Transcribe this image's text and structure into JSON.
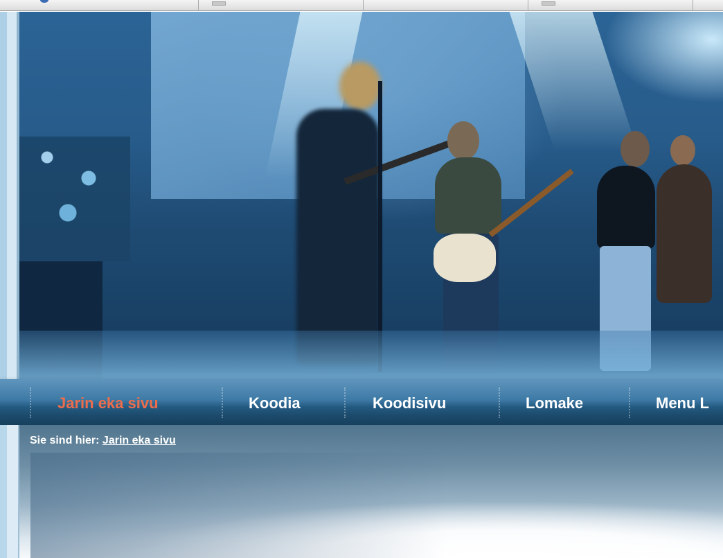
{
  "nav": {
    "items": [
      {
        "label": "Jarin eka sivu",
        "active": true
      },
      {
        "label": "Koodia",
        "active": false
      },
      {
        "label": "Koodisivu",
        "active": false
      },
      {
        "label": "Lomake",
        "active": false
      },
      {
        "label": "Menu L",
        "active": false
      }
    ],
    "active_color": "#ec6d4c",
    "text_color": "#ffffff"
  },
  "breadcrumb": {
    "prefix": "Sie sind hier:",
    "link": "Jarin eka sivu"
  },
  "hero": {
    "image": "concert-band-photo"
  },
  "colors": {
    "nav_top": "#5f95bd",
    "nav_bottom": "#17405d",
    "content_top": "#52768f"
  }
}
